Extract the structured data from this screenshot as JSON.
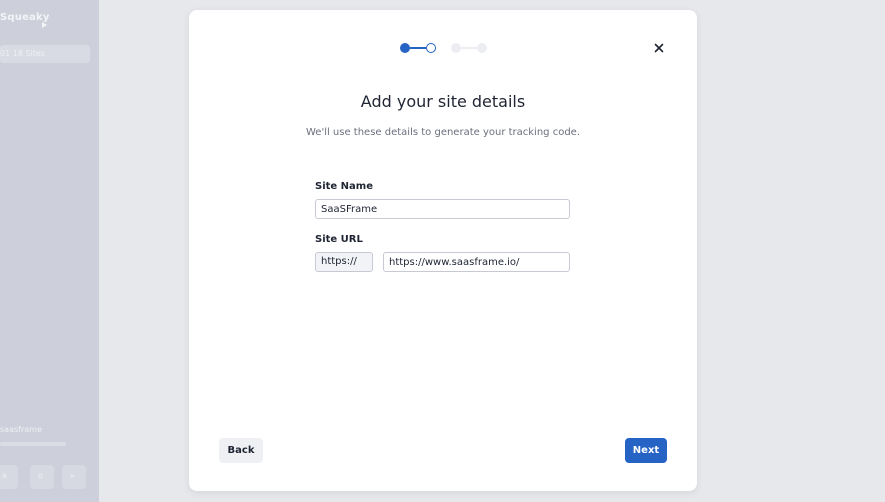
{
  "background": {
    "logo": "Squeaky",
    "nav_item": "01  18 Sites",
    "user_name": "saasframe",
    "footer_icons": [
      "a",
      "o",
      "»"
    ]
  },
  "modal": {
    "title": "Add your site details",
    "subtitle": "We'll use these details to generate your tracking code.",
    "steps": {
      "total": 4,
      "current": 2
    },
    "site_name": {
      "label": "Site Name",
      "value": "SaaSFrame"
    },
    "site_url": {
      "label": "Site URL",
      "protocol": "https://",
      "value": "https://www.saasframe.io/"
    },
    "back_label": "Back",
    "next_label": "Next"
  },
  "colors": {
    "accent": "#2563c4",
    "step_inactive": "#e6e8ee",
    "text_dark": "#1f2433",
    "text_muted": "#6b6f7d"
  },
  "icons": {
    "close": "close-icon",
    "logo_play": "play-icon"
  }
}
